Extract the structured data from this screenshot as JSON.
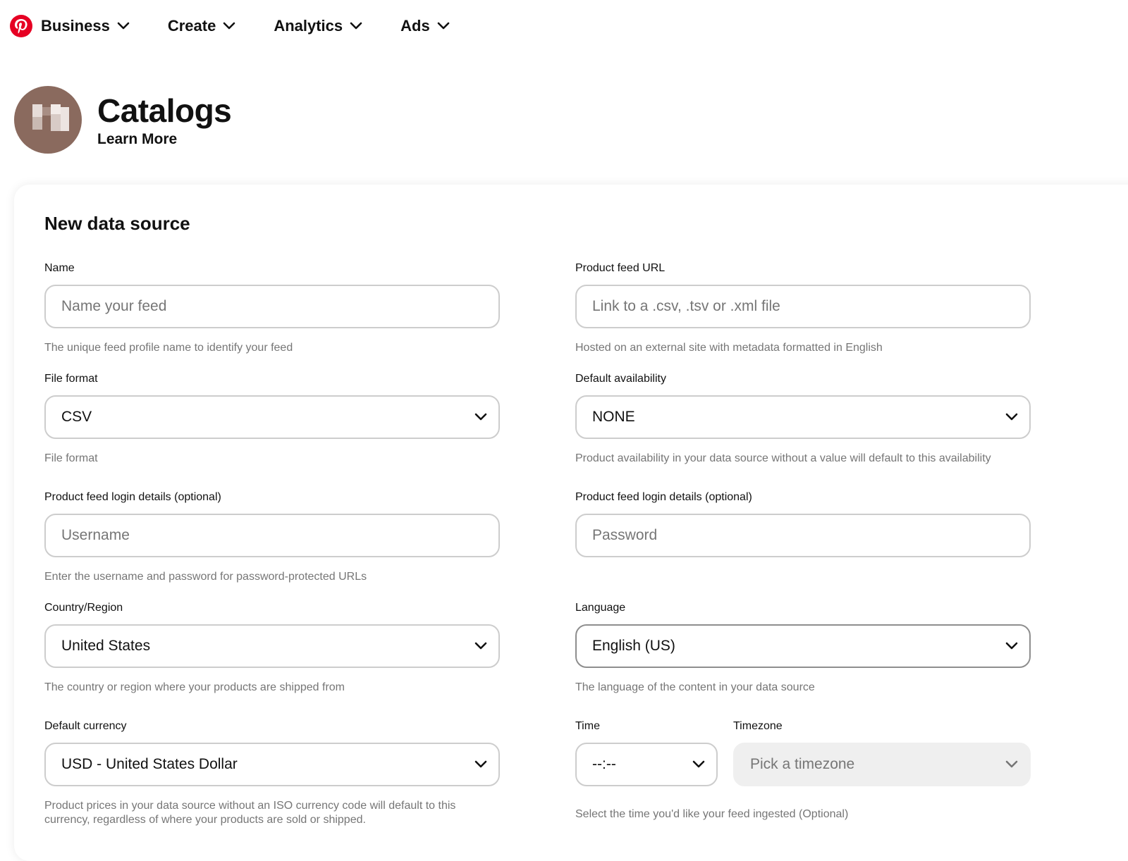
{
  "nav": {
    "items": [
      {
        "label": "Business"
      },
      {
        "label": "Create"
      },
      {
        "label": "Analytics"
      },
      {
        "label": "Ads"
      }
    ]
  },
  "header": {
    "title": "Catalogs",
    "learn_more": "Learn More"
  },
  "form": {
    "title": "New data source",
    "name": {
      "label": "Name",
      "placeholder": "Name your feed",
      "help": "The unique feed profile name to identify your feed"
    },
    "feed_url": {
      "label": "Product feed URL",
      "placeholder": "Link to a .csv, .tsv or .xml file",
      "help": "Hosted on an external site with metadata formatted in English"
    },
    "file_format": {
      "label": "File format",
      "value": "CSV",
      "help": "File format"
    },
    "availability": {
      "label": "Default availability",
      "value": "NONE",
      "help": "Product availability in your data source without a value will default to this availability"
    },
    "login_user": {
      "label": "Product feed login details (optional)",
      "placeholder": "Username",
      "help": "Enter the username and password for password-protected URLs"
    },
    "login_pass": {
      "label": "Product feed login details (optional)",
      "placeholder": "Password"
    },
    "country": {
      "label": "Country/Region",
      "value": "United States",
      "help": "The country or region where your products are shipped from"
    },
    "language": {
      "label": "Language",
      "value": "English (US)",
      "help": "The language of the content in your data source"
    },
    "currency": {
      "label": "Default currency",
      "value": "USD - United States Dollar",
      "help": "Product prices in your data source without an ISO currency code will default to this currency, regardless of where your products are sold or shipped."
    },
    "time": {
      "label": "Time",
      "value": "--:--"
    },
    "timezone": {
      "label": "Timezone",
      "value": "Pick a timezone",
      "help": "Select the time you'd like your feed ingested (Optional)"
    }
  },
  "colors": {
    "brand": "#e60023",
    "border": "#cdcdcd",
    "muted": "#767676",
    "disabled_bg": "#efefef"
  }
}
